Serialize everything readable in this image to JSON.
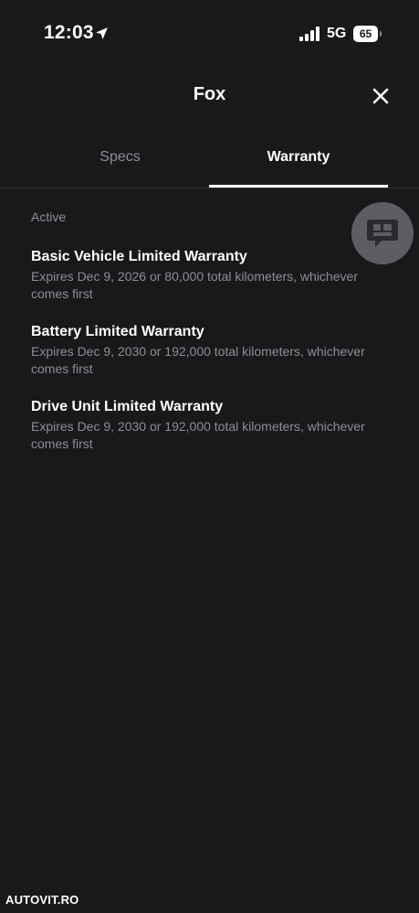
{
  "status_bar": {
    "time": "12:03",
    "network": "5G",
    "battery": "65",
    "icons": [
      "location-arrow-icon",
      "signal-bars-icon",
      "battery-icon"
    ]
  },
  "header": {
    "title": "Fox",
    "close_icon": "close-icon"
  },
  "tabs": [
    {
      "label": "Specs",
      "active": false
    },
    {
      "label": "Warranty",
      "active": true
    }
  ],
  "section": {
    "label": "Active"
  },
  "warranties": [
    {
      "title": "Basic Vehicle Limited Warranty",
      "description": "Expires Dec 9, 2026 or 80,000 total kilometers, whichever comes first"
    },
    {
      "title": "Battery Limited Warranty",
      "description": "Expires Dec 9, 2030 or 192,000 total kilometers, whichever comes first"
    },
    {
      "title": "Drive Unit Limited Warranty",
      "description": "Expires Dec 9, 2030 or 192,000 total kilometers, whichever comes first"
    }
  ],
  "chat_button": {
    "icon": "chat-bubble-icon"
  },
  "watermark": "AUTOVIT.RO",
  "colors": {
    "background": "#18191b",
    "text_primary": "#ffffff",
    "text_secondary": "#8c8e93",
    "chat_button_bg": "#5d5e62"
  }
}
